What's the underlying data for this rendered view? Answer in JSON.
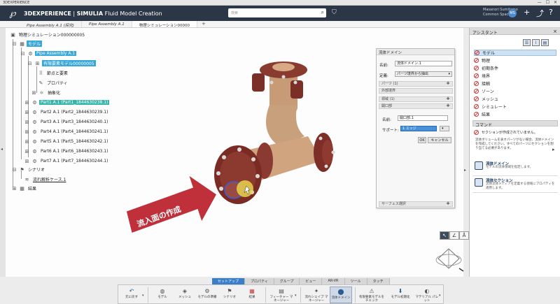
{
  "window": {
    "title": "3DEXPERIENCE"
  },
  "header": {
    "brand": "3DEXPERIENCE",
    "separator": " | ",
    "company": "SIMULIA",
    "app": " Fluid Model Creation",
    "search_placeholder": "検索",
    "user_name": "Masanori Sumitomo",
    "user_space": "Common Space ▾",
    "avatar_initials": "MS"
  },
  "tabs": [
    {
      "label": "Pipe Assembly A.1 (探究)"
    },
    {
      "label": "Pipe Assembly A.1"
    },
    {
      "label": "物理シミュレーション00000"
    }
  ],
  "tree": {
    "root": "物理シミュレーション000000005",
    "model": "モデル",
    "assembly": "Pipe Assembly A.1",
    "fem": "有限要素モデル00000005",
    "nodes": "節点と要素",
    "props": "プロパティ",
    "abstraction": "抽象化",
    "parts": [
      "Part1 A.1 (Part1_1844630238.1)",
      "Part2 A.1 (Part2_1844630239.1)",
      "Part3 A.1 (Part3_1844630240.1)",
      "Part4 A.1 (Part4_1844630241.1)",
      "Part5 A.1 (Part5_1844630242.1)",
      "Part6 A.1 (Part6_1844630243.1)",
      "Part7 A.1 (Part7_1844630244.1)"
    ],
    "scenario": "シナリオ",
    "case": "流れ解析ケース.1",
    "results": "結果"
  },
  "callout": {
    "text": "流入面の作成"
  },
  "domain_panel": {
    "title": "流体ドメイン",
    "name_label": "名前:",
    "name_value": "流体ドメイン.1",
    "def_label": "定義:",
    "def_value": "パーツ境界から抽出",
    "sections": [
      "パーツ (1)",
      "外部境界",
      "領域 (1)",
      "開口部"
    ],
    "open_name_label": "名前:",
    "open_name_value": "開口部.1",
    "support_label": "サポート:",
    "support_value": "1 エッジ",
    "ok": "OK",
    "cancel": "キャンセル",
    "surface_section": "サーフェス選択"
  },
  "assistant": {
    "title": "アシスタント",
    "close": "×",
    "items": [
      "モデル",
      "物理",
      "初期条件",
      "境界",
      "接触",
      "ゾーン",
      "メッシュ",
      "シミュレート",
      "結果"
    ],
    "command_title": "コマンド",
    "command_msg": "セクションが作成されていません。",
    "command_text": "流体ボリュームを表すパーツがない場合、流体ドメインを作成してください。すべてのパーツにセクションを割り当てる必要があります。",
    "cards": [
      {
        "title": "流体ドメイン",
        "desc": "モデルの流体領域を指定します。"
      },
      {
        "title": "流体セクション",
        "desc": "流体流体メディアを定義する領域にプロパティを適用します。"
      }
    ]
  },
  "action_tabs": [
    "セットアップ",
    "プロパティ",
    "グループ",
    "ビュー",
    "AR-VR",
    "ツール",
    "タッチ"
  ],
  "action_buttons": [
    {
      "label": "元に戻す",
      "icon": "↶"
    },
    {
      "label": "モデル",
      "icon": "◍"
    },
    {
      "label": "メッシュ",
      "icon": "◈"
    },
    {
      "label": "モデルの準備",
      "icon": "⚙"
    },
    {
      "label": "シナリオ",
      "icon": "⚑"
    },
    {
      "label": "結果",
      "icon": "▦"
    },
    {
      "label": "フィーチャー マネージャー",
      "icon": "▤"
    },
    {
      "label": "流れシェイプ マネージャー",
      "icon": "✦"
    },
    {
      "label": "流体ドメイン",
      "icon": "⬤"
    },
    {
      "label": "有限要素モデルをチェック",
      "icon": "⚠"
    },
    {
      "label": "モデル初期化",
      "icon": "⬇"
    },
    {
      "label": "マテリアル パレット",
      "icon": "◐"
    }
  ],
  "colors": {
    "header_bg": "#2b3746",
    "selection": "#3aa7d9",
    "callout": "#c0303a",
    "accent": "#3b7ec8"
  }
}
